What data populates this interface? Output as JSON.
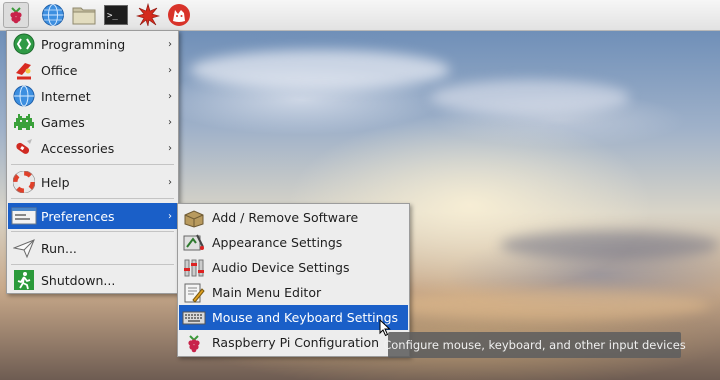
{
  "taskbar": {
    "buttons": [
      {
        "name": "raspberry-menu",
        "icon": "raspberry-icon"
      },
      {
        "name": "web-browser",
        "icon": "globe-icon"
      },
      {
        "name": "file-manager",
        "icon": "folder-icon"
      },
      {
        "name": "terminal",
        "icon": "terminal-icon"
      },
      {
        "name": "mathematica",
        "icon": "spikey-icon"
      },
      {
        "name": "wolfram",
        "icon": "wolf-icon"
      }
    ],
    "terminal_prompt": ">_"
  },
  "main_menu": {
    "items": [
      {
        "label": "Programming",
        "icon": "programming-icon",
        "submenu": true
      },
      {
        "label": "Office",
        "icon": "office-icon",
        "submenu": true
      },
      {
        "label": "Internet",
        "icon": "globe-icon",
        "submenu": true
      },
      {
        "label": "Games",
        "icon": "space-invader-icon",
        "submenu": true
      },
      {
        "label": "Accessories",
        "icon": "swiss-knife-icon",
        "submenu": true
      },
      {
        "label": "Help",
        "icon": "lifebuoy-icon",
        "submenu": true
      },
      {
        "label": "Preferences",
        "icon": "preferences-icon",
        "submenu": true,
        "active": true
      },
      {
        "label": "Run...",
        "icon": "paper-plane-icon",
        "submenu": false
      },
      {
        "label": "Shutdown...",
        "icon": "exit-icon",
        "submenu": false
      }
    ],
    "arrow": "›"
  },
  "preferences_submenu": {
    "items": [
      {
        "label": "Add / Remove Software",
        "icon": "package-icon"
      },
      {
        "label": "Appearance Settings",
        "icon": "appearance-icon"
      },
      {
        "label": "Audio Device Settings",
        "icon": "mixer-icon"
      },
      {
        "label": "Main Menu Editor",
        "icon": "menu-editor-icon"
      },
      {
        "label": "Mouse and Keyboard Settings",
        "icon": "keyboard-icon",
        "active": true
      },
      {
        "label": "Raspberry Pi Configuration",
        "icon": "raspberry-icon"
      }
    ]
  },
  "tooltip": {
    "text": "Configure mouse, keyboard, and other input devices"
  },
  "colors": {
    "highlight": "#1a5fc8",
    "menu_bg": "#ededed",
    "tooltip_bg": "#5f5f5f"
  }
}
